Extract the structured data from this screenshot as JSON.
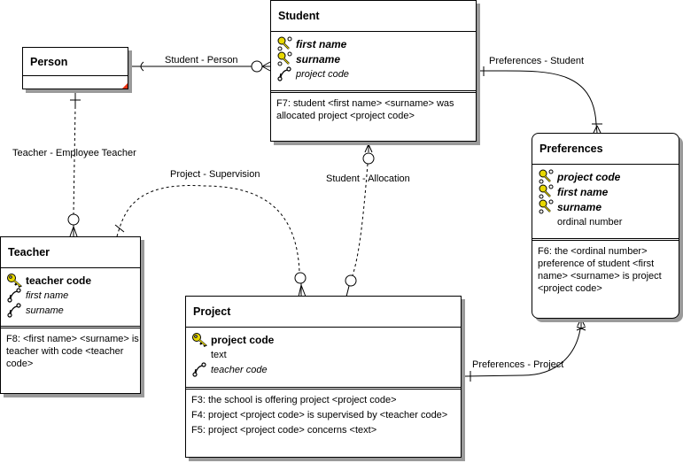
{
  "diagram": {
    "entities": {
      "student": {
        "title": "Student",
        "attributes": [
          {
            "name": "first name",
            "kind": "key-foreign",
            "icon": "key-link-icon"
          },
          {
            "name": "surname",
            "kind": "key-foreign",
            "icon": "key-link-icon"
          },
          {
            "name": "project code",
            "kind": "foreign",
            "icon": "link-icon"
          }
        ],
        "facts": [
          "F7: student <first name> <surname> was allocated project <project code>"
        ]
      },
      "person": {
        "title": "Person",
        "attributes": [],
        "facts": []
      },
      "preferences": {
        "title": "Preferences",
        "attributes": [
          {
            "name": "project code",
            "kind": "key-foreign",
            "icon": "key-link-icon"
          },
          {
            "name": "first name",
            "kind": "key-foreign",
            "icon": "key-link-icon"
          },
          {
            "name": "surname",
            "kind": "key-foreign",
            "icon": "key-link-icon"
          },
          {
            "name": "ordinal number",
            "kind": "plain",
            "icon": ""
          }
        ],
        "facts": [
          "F6: the <ordinal number> preference of student <first name> <surname> is project <project code>"
        ]
      },
      "teacher": {
        "title": "Teacher",
        "attributes": [
          {
            "name": "teacher code",
            "kind": "key",
            "icon": "key-icon"
          },
          {
            "name": "first name",
            "kind": "foreign",
            "icon": "link-icon"
          },
          {
            "name": "surname",
            "kind": "foreign",
            "icon": "link-icon"
          }
        ],
        "facts": [
          "F8: <first name> <surname> is teacher with code <teacher code>"
        ]
      },
      "project": {
        "title": "Project",
        "attributes": [
          {
            "name": "project code",
            "kind": "key",
            "icon": "key-icon"
          },
          {
            "name": "text",
            "kind": "plain",
            "icon": ""
          },
          {
            "name": "teacher code",
            "kind": "foreign",
            "icon": "link-icon"
          }
        ],
        "facts": [
          "F3: the school is offering project <project code>",
          "F4: project <project code> is supervised by <teacher code>",
          "F5: project <project code> concerns <text>"
        ]
      }
    },
    "relationships": {
      "student_person": "Student - Person",
      "preferences_student": "Preferences - Student",
      "teacher_employee": "Teacher - Employee Teacher",
      "project_supervision": "Project - Supervision",
      "student_allocation": "Student - Allocation",
      "preferences_project": "Preferences - Project"
    },
    "colors": {
      "key_gold": "#e8d800",
      "corner_marker": "#e83010",
      "shadow": "#9a9a9a"
    }
  }
}
